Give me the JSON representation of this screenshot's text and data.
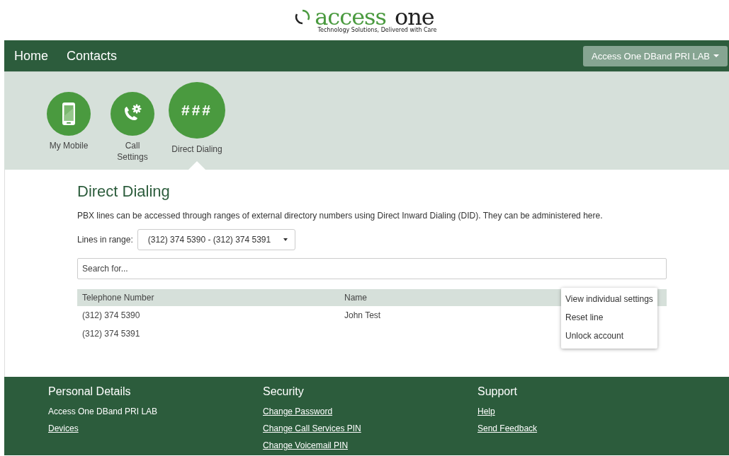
{
  "logo": {
    "word1": "access",
    "word2": "one",
    "tagline": "Technology Solutions, Delivered with Care"
  },
  "nav": {
    "links": [
      "Home",
      "Contacts"
    ],
    "account": "Access One DBand PRI LAB"
  },
  "features": [
    {
      "label": "My Mobile",
      "kind": "mobile",
      "selected": false
    },
    {
      "label": "Call Settings",
      "kind": "settings",
      "selected": false
    },
    {
      "label": "Direct Dialing",
      "kind": "glyph",
      "glyph": "###",
      "selected": true
    }
  ],
  "page": {
    "title": "Direct Dialing",
    "description": "PBX lines can be accessed through ranges of external directory numbers using Direct Inward Dialing (DID). They can be administered here.",
    "range_label": "Lines in range:",
    "range_value": "(312) 374 5390 - (312) 374 5391",
    "search_placeholder": "Search for..."
  },
  "table": {
    "columns": [
      "Telephone Number",
      "Name"
    ],
    "rows": [
      {
        "number": "(312) 374 5390",
        "name": "John Test"
      },
      {
        "number": "(312) 374 5391"
      }
    ]
  },
  "context_menu": [
    "View individual settings",
    "Reset line",
    "Unlock account"
  ],
  "footer": [
    {
      "title": "Personal Details",
      "items": [
        {
          "text": "Access One DBand PRI LAB",
          "link": false
        },
        {
          "text": "Devices",
          "link": true
        }
      ]
    },
    {
      "title": "Security",
      "items": [
        {
          "text": "Change Password",
          "link": true
        },
        {
          "text": "Change Call Services PIN",
          "link": true
        },
        {
          "text": "Change Voicemail PIN",
          "link": true
        }
      ]
    },
    {
      "title": "Support",
      "items": [
        {
          "text": "Help",
          "link": true
        },
        {
          "text": "Send Feedback",
          "link": true
        }
      ]
    }
  ]
}
